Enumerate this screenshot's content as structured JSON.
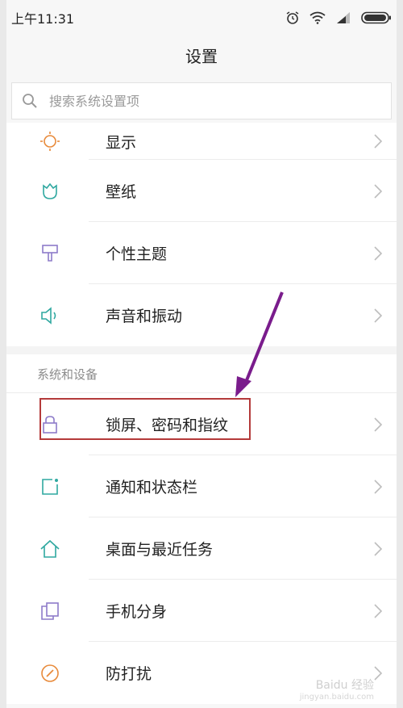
{
  "statusbar": {
    "time": "上午11:31"
  },
  "header": {
    "title": "设置"
  },
  "search": {
    "placeholder": "搜索系统设置项"
  },
  "items_top": [
    {
      "label": "显示"
    },
    {
      "label": "壁纸"
    },
    {
      "label": "个性主题"
    },
    {
      "label": "声音和振动"
    }
  ],
  "section": {
    "title": "系统和设备"
  },
  "items_bottom": [
    {
      "label": "锁屏、密码和指纹"
    },
    {
      "label": "通知和状态栏"
    },
    {
      "label": "桌面与最近任务"
    },
    {
      "label": "手机分身"
    },
    {
      "label": "防打扰"
    }
  ],
  "colors": {
    "accent_teal": "#2fa8a0",
    "icon_orange": "#e88a3a",
    "icon_purple": "#8d7bc9",
    "highlight_red": "#b43a3a",
    "arrow_purple": "#7a1c8c"
  },
  "watermark": {
    "brand": "Baidu 经验",
    "url": "jingyan.baidu.com"
  }
}
